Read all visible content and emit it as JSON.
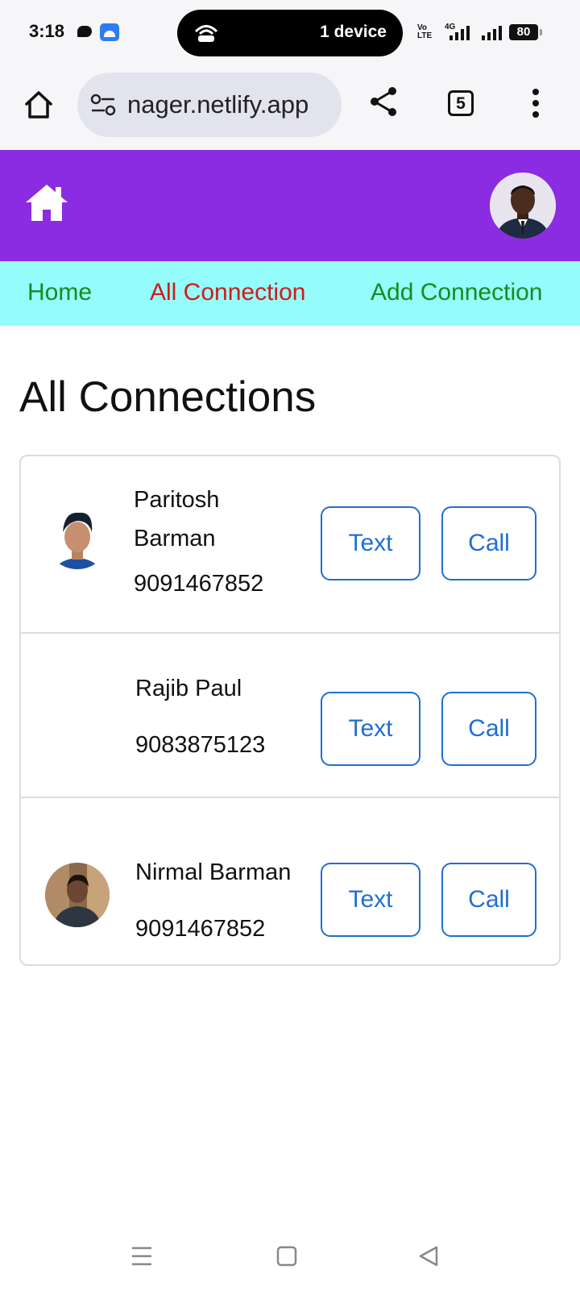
{
  "status_bar": {
    "time": "3:18",
    "hotspot_text": "1 device",
    "network_labels": [
      "Vo",
      "LTE",
      "4G"
    ],
    "battery": "80",
    "icons": [
      "chat-icon",
      "android-icon",
      "hotspot-icon",
      "signal-icon",
      "battery-icon"
    ]
  },
  "browser": {
    "url": "nager.netlify.app",
    "tab_count": "5",
    "icons": [
      "home-icon",
      "site-settings-icon",
      "share-icon",
      "tabs-icon",
      "more-vert-icon"
    ]
  },
  "app_header": {
    "home_icon": "house-icon",
    "avatar": "profile-avatar",
    "brand_color": "#8b2be2"
  },
  "nav": {
    "home": "Home",
    "all_connection": "All Connection",
    "add_connection": "Add Connection",
    "home_color": "#198a1f",
    "active_color": "#d11a1a",
    "background": "#94fcfa"
  },
  "main": {
    "title": "All Connections",
    "connections": [
      {
        "name_line1": "Paritosh",
        "name_line2": "Barman",
        "phone": "9091467852",
        "text_label": "Text",
        "call_label": "Call",
        "has_photo": true
      },
      {
        "name": "Rajib Paul",
        "phone": "9083875123",
        "text_label": "Text",
        "call_label": "Call",
        "has_photo": false
      },
      {
        "name": "Nirmal Barman",
        "phone": "9091467852",
        "text_label": "Text",
        "call_label": "Call",
        "has_photo": true
      }
    ],
    "button_color": "#1f6fd1"
  },
  "system_nav": {
    "icons": [
      "recents-icon",
      "home-square-icon",
      "back-icon"
    ]
  }
}
